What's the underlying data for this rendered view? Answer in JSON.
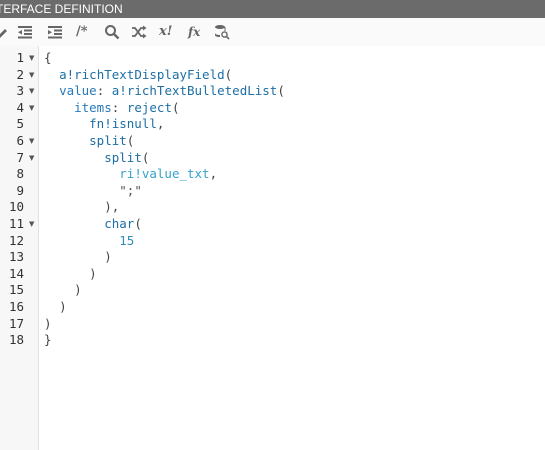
{
  "window": {
    "title": "TERFACE DEFINITION"
  },
  "toolbar": {
    "items": [
      {
        "name": "wrap",
        "icon": "pencil-icon"
      },
      {
        "name": "outdent",
        "icon": "outdent-icon"
      },
      {
        "name": "indent",
        "icon": "indent-icon"
      },
      {
        "name": "comment",
        "label": "/*",
        "icon": "comment-icon"
      },
      {
        "name": "search",
        "icon": "search-icon"
      },
      {
        "name": "shuffle",
        "icon": "shuffle-icon"
      },
      {
        "name": "expression",
        "label": "x!",
        "icon": "x-bang-icon"
      },
      {
        "name": "function",
        "label": "fx",
        "icon": "function-icon"
      },
      {
        "name": "database",
        "icon": "database-search-icon"
      }
    ]
  },
  "editor": {
    "line_numbers": [
      "1",
      "2",
      "3",
      "4",
      "5",
      "6",
      "7",
      "8",
      "9",
      "10",
      "11",
      "12",
      "13",
      "14",
      "15",
      "16",
      "17",
      "18"
    ],
    "foldable": [
      true,
      true,
      true,
      true,
      false,
      true,
      true,
      false,
      false,
      false,
      true,
      false,
      false,
      false,
      false,
      false,
      false,
      false
    ],
    "lines": [
      {
        "tokens": [
          {
            "t": "{",
            "c": "p"
          }
        ]
      },
      {
        "tokens": [
          {
            "t": "  ",
            "c": "p"
          },
          {
            "t": "a!richTextDisplayField",
            "c": "fn"
          },
          {
            "t": "(",
            "c": "p"
          }
        ]
      },
      {
        "tokens": [
          {
            "t": "  ",
            "c": "p"
          },
          {
            "t": "value",
            "c": "kw"
          },
          {
            "t": ": ",
            "c": "p"
          },
          {
            "t": "a!richTextBulletedList",
            "c": "fn"
          },
          {
            "t": "(",
            "c": "p"
          }
        ]
      },
      {
        "tokens": [
          {
            "t": "    ",
            "c": "p"
          },
          {
            "t": "items",
            "c": "kw"
          },
          {
            "t": ": ",
            "c": "p"
          },
          {
            "t": "reject",
            "c": "fn"
          },
          {
            "t": "(",
            "c": "p"
          }
        ]
      },
      {
        "tokens": [
          {
            "t": "      ",
            "c": "p"
          },
          {
            "t": "fn!isnull",
            "c": "fn"
          },
          {
            "t": ",",
            "c": "p"
          }
        ]
      },
      {
        "tokens": [
          {
            "t": "      ",
            "c": "p"
          },
          {
            "t": "split",
            "c": "fn"
          },
          {
            "t": "(",
            "c": "p"
          }
        ]
      },
      {
        "tokens": [
          {
            "t": "        ",
            "c": "p"
          },
          {
            "t": "split",
            "c": "fn"
          },
          {
            "t": "(",
            "c": "p"
          }
        ]
      },
      {
        "tokens": [
          {
            "t": "          ",
            "c": "p"
          },
          {
            "t": "ri!value_txt",
            "c": "ri"
          },
          {
            "t": ",",
            "c": "p"
          }
        ]
      },
      {
        "tokens": [
          {
            "t": "          ",
            "c": "p"
          },
          {
            "t": "\";\"",
            "c": "str"
          }
        ]
      },
      {
        "tokens": [
          {
            "t": "        ",
            "c": "p"
          },
          {
            "t": "),",
            "c": "p"
          }
        ]
      },
      {
        "tokens": [
          {
            "t": "        ",
            "c": "p"
          },
          {
            "t": "char",
            "c": "fn"
          },
          {
            "t": "(",
            "c": "p"
          }
        ]
      },
      {
        "tokens": [
          {
            "t": "          ",
            "c": "p"
          },
          {
            "t": "15",
            "c": "num"
          }
        ]
      },
      {
        "tokens": [
          {
            "t": "        ",
            "c": "p"
          },
          {
            "t": ")",
            "c": "p"
          }
        ]
      },
      {
        "tokens": [
          {
            "t": "      ",
            "c": "p"
          },
          {
            "t": ")",
            "c": "p"
          }
        ]
      },
      {
        "tokens": [
          {
            "t": "    ",
            "c": "p"
          },
          {
            "t": ")",
            "c": "p"
          }
        ]
      },
      {
        "tokens": [
          {
            "t": "  ",
            "c": "p"
          },
          {
            "t": ")",
            "c": "p"
          }
        ]
      },
      {
        "tokens": [
          {
            "t": ")",
            "c": "p"
          }
        ]
      },
      {
        "tokens": [
          {
            "t": "}",
            "c": "p"
          }
        ]
      }
    ]
  },
  "colors": {
    "title_bar": "#6b6b6b",
    "function": "#1d6fa5",
    "keyword": "#2979ba",
    "rule_input": "#36a3c9",
    "gutter": "#f7f7f7"
  }
}
